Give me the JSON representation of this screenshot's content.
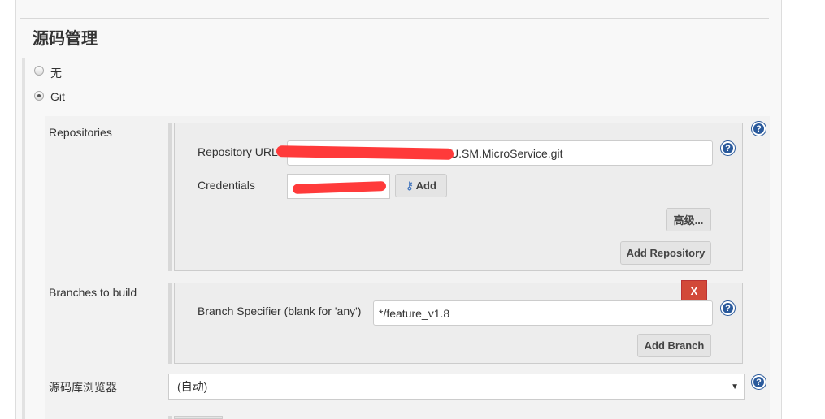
{
  "section": {
    "title": "源码管理"
  },
  "scm": {
    "options": [
      {
        "label": "无",
        "selected": false
      },
      {
        "label": "Git",
        "selected": true
      }
    ]
  },
  "repositories": {
    "label": "Repositories",
    "url_label": "Repository URL",
    "url_value": "U.SM.MicroService.git",
    "credentials_label": "Credentials",
    "add_label": "Add",
    "advanced_label": "高级...",
    "add_repository_label": "Add Repository"
  },
  "branches": {
    "label": "Branches to build",
    "delete_label": "X",
    "specifier_label": "Branch Specifier (blank for 'any')",
    "specifier_value": "*/feature_v1.8",
    "add_branch_label": "Add Branch"
  },
  "browser": {
    "label": "源码库浏览器",
    "selected": "(自动)"
  },
  "colors": {
    "delete": "#d24939",
    "help": "#2a5a9c",
    "redaction": "#ff3a3a"
  }
}
